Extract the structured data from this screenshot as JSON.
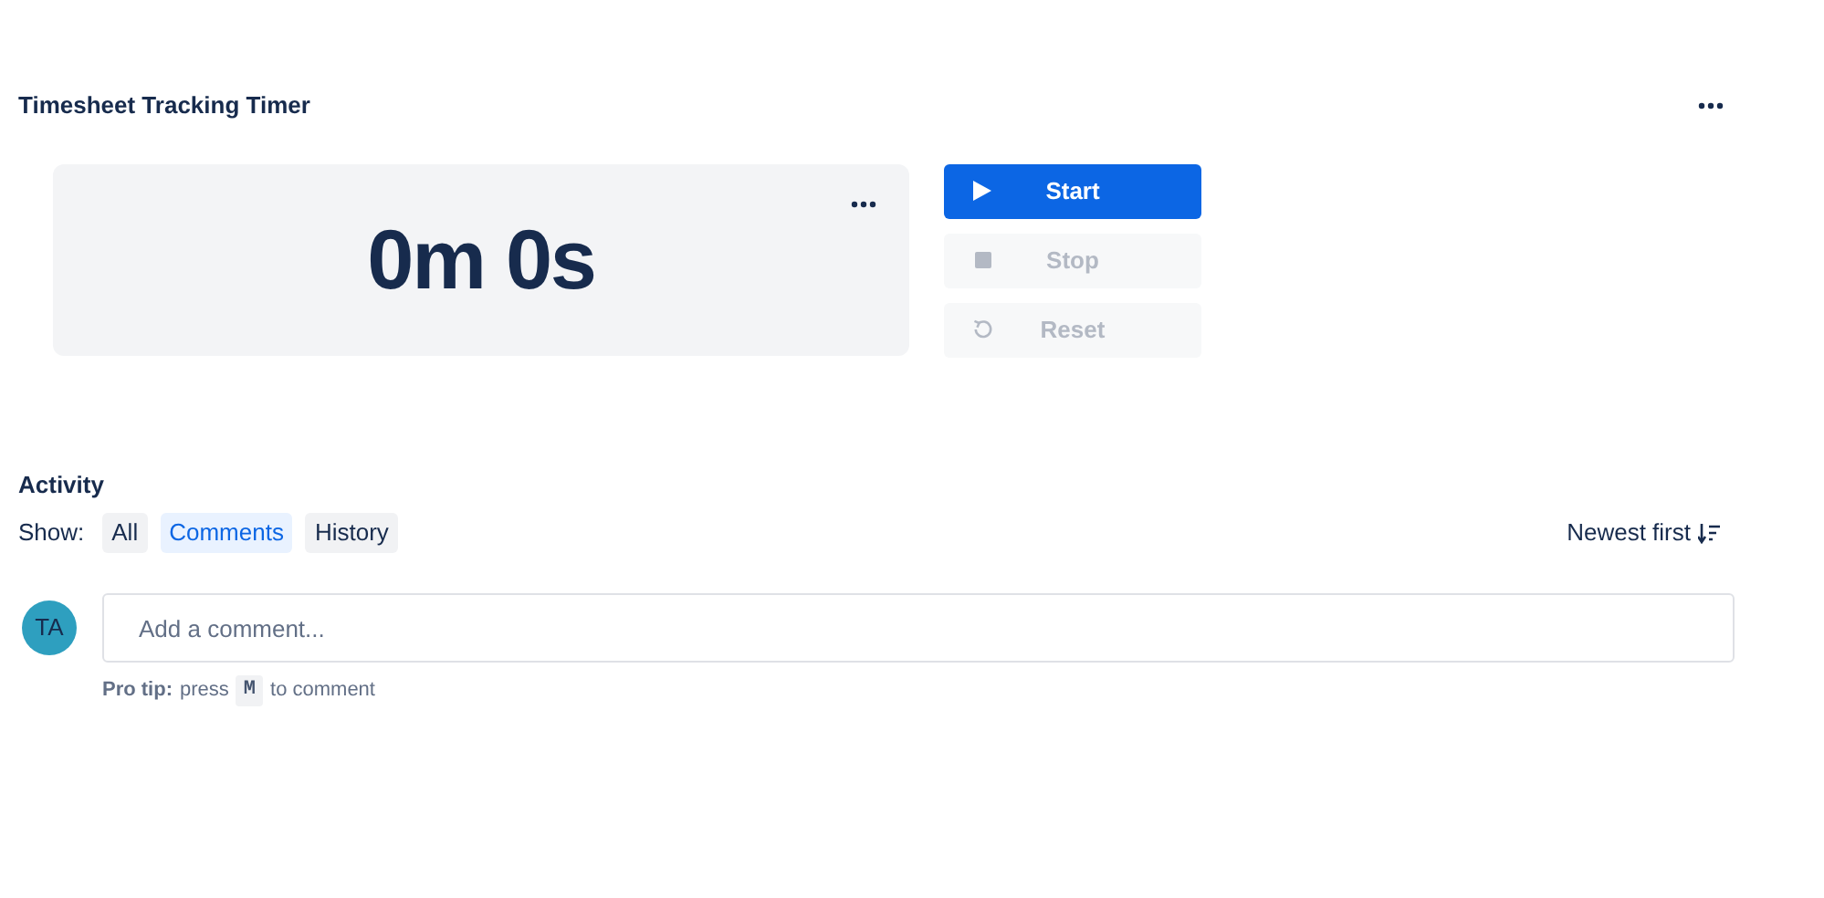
{
  "panel": {
    "title": "Timesheet Tracking Timer"
  },
  "timer": {
    "display": "0m 0s"
  },
  "controls": [
    {
      "kind": "start",
      "label": "Start",
      "disabled": false
    },
    {
      "kind": "stop",
      "label": "Stop",
      "disabled": true
    },
    {
      "kind": "reset",
      "label": "Reset",
      "disabled": true
    }
  ],
  "activity": {
    "title": "Activity",
    "show_label": "Show:",
    "filters": [
      {
        "label": "All",
        "selected": false
      },
      {
        "label": "Comments",
        "selected": true
      },
      {
        "label": "History",
        "selected": false
      }
    ],
    "sort": "Newest first"
  },
  "comment": {
    "avatar": "TA",
    "placeholder": "Add a comment...",
    "tip_bold": "Pro tip:",
    "tip_before": "press",
    "tip_key": "M",
    "tip_after": "to comment"
  }
}
